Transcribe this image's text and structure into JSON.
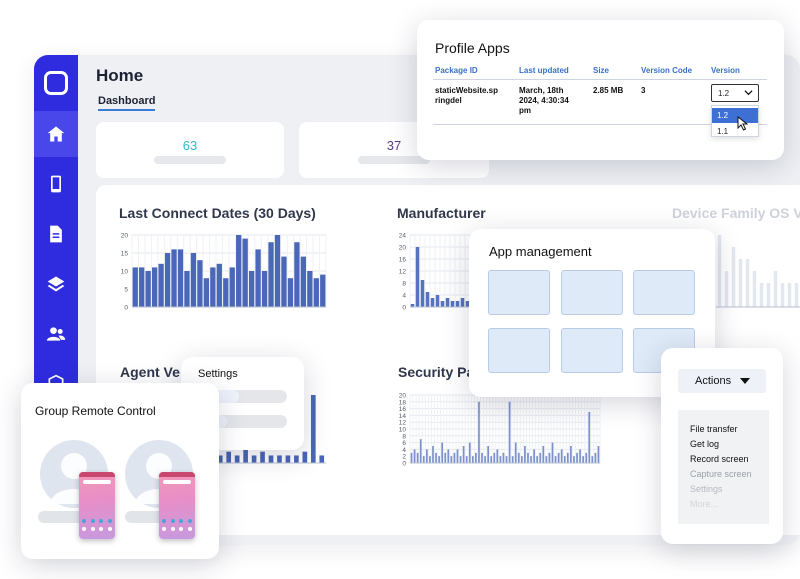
{
  "dashboard": {
    "title": "Home",
    "tab": "Dashboard",
    "stats": [
      {
        "value": "63",
        "color": "#35b6c9"
      },
      {
        "value": "37",
        "color": "#5b3e86"
      }
    ],
    "panels": {
      "last_connect": "Last Connect Dates (30 Days)",
      "manufacturer": "Manufacturer",
      "device_family": "Device Family OS V",
      "agent": "Agent Ve",
      "security": "Security Pa"
    }
  },
  "sidebar": {
    "icons": [
      "logo-icon",
      "home-icon",
      "phone-icon",
      "document-icon",
      "layers-icon",
      "users-icon",
      "shield-icon"
    ]
  },
  "profile_apps": {
    "title": "Profile Apps",
    "headers": [
      "Package ID",
      "Last updated",
      "Size",
      "Version Code",
      "Version"
    ],
    "row": {
      "package": [
        "staticWebsite.sp",
        "ringdel"
      ],
      "updated": [
        "March, 18th",
        "2024, 4:30:34",
        "pm"
      ],
      "size": "2.85 MB",
      "code": "3"
    },
    "version_select": "1.2",
    "version_options": [
      "1.2",
      "1.1"
    ]
  },
  "app_management": {
    "title": "App management"
  },
  "settings": {
    "title": "Settings"
  },
  "group_remote": {
    "title": "Group Remote Control"
  },
  "actions": {
    "button": "Actions",
    "items": [
      {
        "label": "File transfer",
        "enabled": true
      },
      {
        "label": "Get log",
        "enabled": true
      },
      {
        "label": "Record screen",
        "enabled": true
      },
      {
        "label": "Capture screen",
        "enabled": false
      },
      {
        "label": "Settings",
        "enabled": false
      },
      {
        "label": "More...",
        "enabled": false
      }
    ]
  },
  "chart_data": [
    {
      "type": "bar",
      "title": "Last Connect Dates (30 Days)",
      "ylim": [
        0,
        20
      ],
      "yticks": [
        "0",
        "5",
        "10",
        "15",
        "20"
      ],
      "values": [
        11,
        11,
        10,
        11,
        12,
        15,
        16,
        16,
        10,
        15,
        13,
        8,
        11,
        12,
        8,
        11,
        20,
        19,
        10,
        16,
        10,
        18,
        20,
        14,
        8,
        18,
        14,
        10,
        8,
        9
      ]
    },
    {
      "type": "bar",
      "title": "Manufacturer",
      "ylim": [
        0,
        24
      ],
      "yticks": [
        "0",
        "4",
        "8",
        "12",
        "16",
        "20",
        "24"
      ],
      "values": [
        1,
        20,
        9,
        5,
        3,
        4,
        2,
        3,
        2,
        2,
        3,
        2
      ]
    },
    {
      "type": "bar",
      "title": "Security Pa",
      "ylim": [
        0,
        20
      ],
      "yticks": [
        "0",
        "2",
        "4",
        "6",
        "8",
        "10",
        "12",
        "14",
        "16",
        "18",
        "20"
      ],
      "values": [
        3,
        4,
        3,
        7,
        2,
        4,
        2,
        5,
        3,
        2,
        6,
        3,
        4,
        2,
        3,
        4,
        2,
        5,
        2,
        6,
        2,
        3,
        18,
        3,
        2,
        5,
        2,
        3,
        4,
        2,
        3,
        2,
        18,
        2,
        6,
        3,
        2,
        5,
        3,
        2,
        4,
        2,
        3,
        5,
        2,
        3,
        6,
        2,
        3,
        4,
        2,
        3,
        5,
        2,
        3,
        4,
        2,
        3,
        15,
        2,
        3,
        5
      ]
    },
    {
      "type": "bar",
      "title": "Agent Ve",
      "values": [
        2,
        3,
        2,
        4,
        2,
        3,
        2,
        2,
        2,
        2,
        3,
        18,
        2
      ]
    },
    {
      "type": "bar",
      "title": "Device Family OS V",
      "values": [
        6,
        3,
        5,
        4,
        4,
        3,
        2,
        2,
        3,
        2,
        2,
        2
      ]
    }
  ]
}
